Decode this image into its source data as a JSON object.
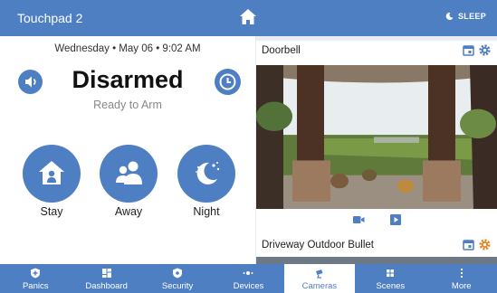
{
  "app": {
    "title": "Touchpad 2",
    "sleep_label": "SLEEP"
  },
  "header": {
    "datetime": "Wednesday  •  May 06  •  9:02 AM"
  },
  "status": {
    "title": "Disarmed",
    "subtitle": "Ready to Arm"
  },
  "arm_modes": [
    {
      "label": "Stay",
      "icon": "home-person-icon"
    },
    {
      "label": "Away",
      "icon": "people-icon"
    },
    {
      "label": "Night",
      "icon": "moon-stars-icon"
    }
  ],
  "cameras": [
    {
      "name": "Doorbell",
      "actions": [
        "video-camera-icon",
        "playback-icon"
      ]
    },
    {
      "name": "Driveway Outdoor Bullet"
    }
  ],
  "nav": [
    {
      "label": "Panics",
      "icon": "shield-plus-icon",
      "active": false
    },
    {
      "label": "Dashboard",
      "icon": "dashboard-icon",
      "active": false
    },
    {
      "label": "Security",
      "icon": "security-shield-icon",
      "active": false
    },
    {
      "label": "Devices",
      "icon": "devices-icon",
      "active": false
    },
    {
      "label": "Cameras",
      "icon": "camera-icon",
      "active": true
    },
    {
      "label": "Scenes",
      "icon": "scenes-icon",
      "active": false
    },
    {
      "label": "More",
      "icon": "more-icon",
      "active": false
    }
  ],
  "colors": {
    "brand": "#4f7fc3",
    "accent_orange": "#e6862b",
    "background": "#e9ecf1"
  }
}
